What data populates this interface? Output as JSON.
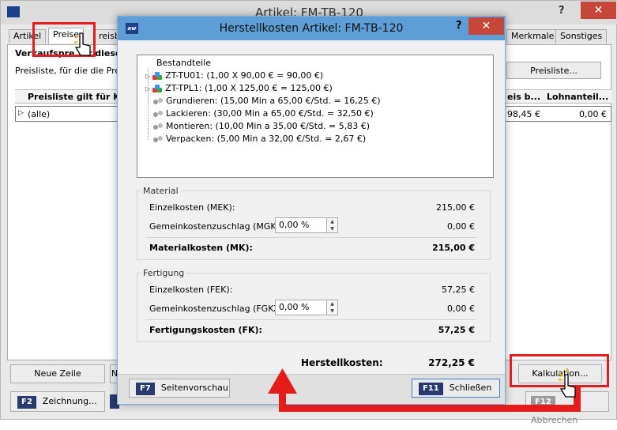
{
  "window": {
    "title": "Artikel: FM-TB-120",
    "help": "?",
    "close": "✕"
  },
  "tabs": [
    {
      "label": "Artikel"
    },
    {
      "label": "Preise"
    },
    {
      "label": "reisbe"
    },
    {
      "label": "Merkmale"
    },
    {
      "label": "Sonstiges"
    }
  ],
  "background": {
    "heading": "Verkaufspre",
    "heading_tail": "r diese",
    "description": "Preisliste, für die die Preise",
    "preisliste_button": "Preisliste...",
    "grid": {
      "col1": "Preisliste gilt für Kun",
      "col2": "eis b...",
      "col3": "Lohnanteil...",
      "row": {
        "expander": "▷",
        "value": "(alle)",
        "price": "98,45 €",
        "lohn": "0,00 €"
      }
    },
    "buttons": {
      "neue_zeile": "Neue Zeile",
      "partial": "N",
      "kalkulation": "Kalkulation..."
    },
    "footer": {
      "f2_key": "F2",
      "f2_label": "Zeichnung...",
      "f12_key": "F12",
      "f12_label": "Abbrechen"
    }
  },
  "modal": {
    "title": "Herstellkosten Artikel: FM-TB-120",
    "help": "?",
    "close": "✕",
    "tree": {
      "root": "Bestandteile",
      "items": [
        {
          "text": "ZT-TU01: (1,00 X 90,00 € = 90,00 €)",
          "icon": "component-icon",
          "expandable": true
        },
        {
          "text": "ZT-TPL1: (1,00 X 125,00 € = 125,00 €)",
          "icon": "component-icon",
          "expandable": true
        },
        {
          "text": "Grundieren: (15,00 Min a 65,00 €/Std. = 16,25 €)",
          "icon": "gears-icon",
          "expandable": false
        },
        {
          "text": "Lackieren: (30,00 Min a 65,00 €/Std. = 32,50 €)",
          "icon": "gears-icon",
          "expandable": false
        },
        {
          "text": "Montieren: (10,00 Min a 35,00 €/Std. = 5,83 €)",
          "icon": "gears-icon",
          "expandable": false
        },
        {
          "text": "Verpacken: (5,00 Min a 32,00 €/Std. = 2,67 €)",
          "icon": "gears-icon",
          "expandable": false
        }
      ]
    },
    "material": {
      "section": "Material",
      "einzel_label": "Einzelkosten (MEK):",
      "einzel_value": "215,00 €",
      "gemein_label": "Gemeinkostenzuschlag (MGKZ):",
      "gemein_input": "0,00 %",
      "gemein_value": "0,00 €",
      "total_label": "Materialkosten (MK):",
      "total_value": "215,00 €"
    },
    "fertigung": {
      "section": "Fertigung",
      "einzel_label": "Einzelkosten (FEK):",
      "einzel_value": "57,25 €",
      "gemein_label": "Gemeinkostenzuschlag (FGKZ):",
      "gemein_input": "0,00 %",
      "gemein_value": "0,00 €",
      "total_label": "Fertigungskosten (FK):",
      "total_value": "57,25 €"
    },
    "herstell_label": "Herstellkosten:",
    "herstell_value": "272,25 €",
    "footer": {
      "f7_key": "F7",
      "f7_label": "Seitenvorschau",
      "f11_key": "F11",
      "f11_label": "Schließen"
    }
  },
  "colors": {
    "accent": "#5e9ed6",
    "annotation": "#e51c1c",
    "fkey": "#2b3a6e"
  }
}
